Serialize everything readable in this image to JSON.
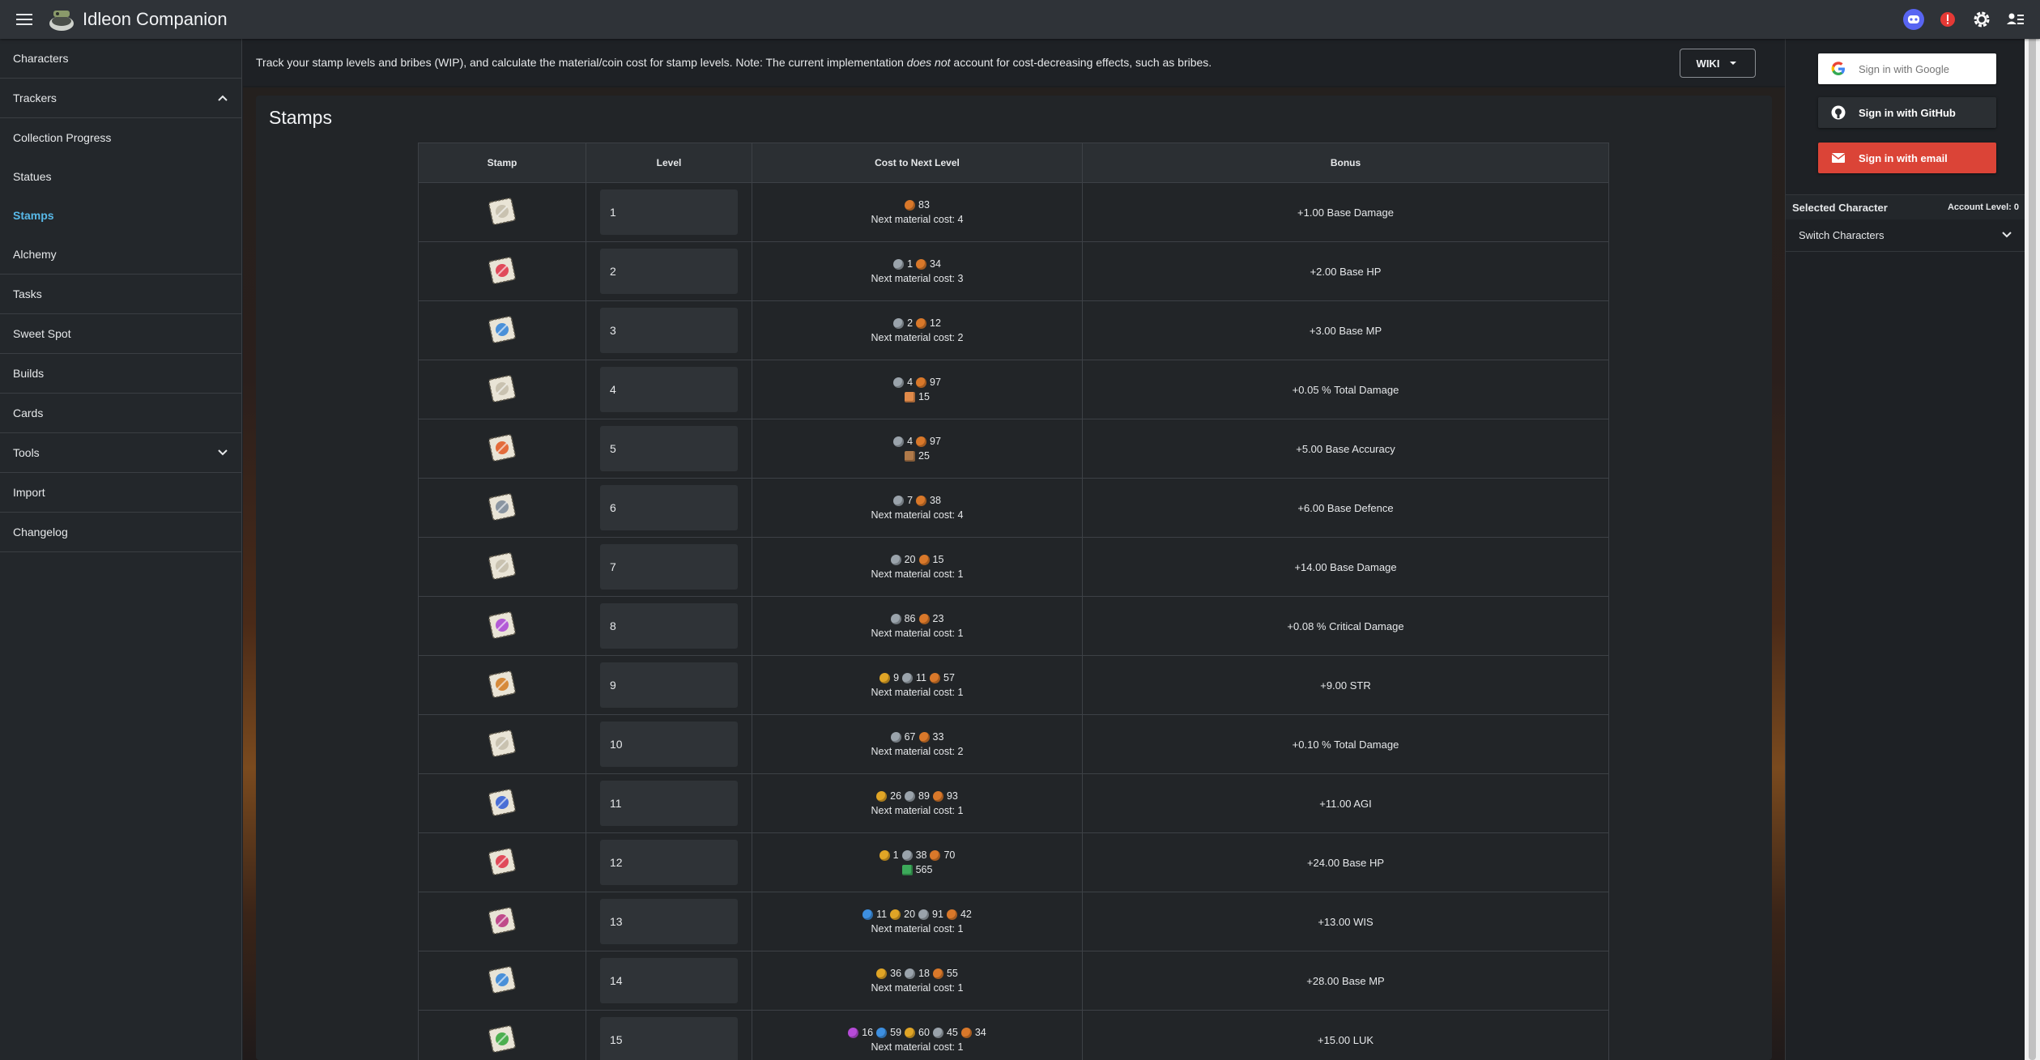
{
  "app": {
    "title": "Idleon Companion"
  },
  "sidebar": {
    "items": [
      {
        "label": "Characters"
      },
      {
        "label": "Trackers"
      },
      {
        "label": "Collection Progress"
      },
      {
        "label": "Statues"
      },
      {
        "label": "Stamps"
      },
      {
        "label": "Alchemy"
      },
      {
        "label": "Tasks"
      },
      {
        "label": "Sweet Spot"
      },
      {
        "label": "Builds"
      },
      {
        "label": "Cards"
      },
      {
        "label": "Tools"
      },
      {
        "label": "Import"
      },
      {
        "label": "Changelog"
      }
    ]
  },
  "info": {
    "text_before": "Track your stamp levels and bribes (WIP), and calculate the material/coin cost for stamp levels. Note: The current implementation ",
    "text_em": "does not",
    "text_after": " account for cost-decreasing effects, such as bribes.",
    "wiki_label": "WIKI"
  },
  "page": {
    "title": "Stamps"
  },
  "table": {
    "headers": [
      "Stamp",
      "Level",
      "Cost to Next Level",
      "Bonus"
    ],
    "rows": [
      {
        "stamp_icon": "sword-stamp-icon",
        "level": "1",
        "cost_line": [
          {
            "coin": "copper",
            "v": "83"
          }
        ],
        "cost_sub": "Next material cost: 4",
        "bonus": "+1.00 Base Damage"
      },
      {
        "stamp_icon": "heart-stamp-icon",
        "level": "2",
        "cost_line": [
          {
            "coin": "silver",
            "v": "1"
          },
          {
            "coin": "copper",
            "v": "34"
          }
        ],
        "cost_sub": "Next material cost: 3",
        "bonus": "+2.00 Base HP"
      },
      {
        "stamp_icon": "mana-stamp-icon",
        "level": "3",
        "cost_line": [
          {
            "coin": "silver",
            "v": "2"
          },
          {
            "coin": "copper",
            "v": "12"
          }
        ],
        "cost_sub": "Next material cost: 2",
        "bonus": "+3.00 Base MP"
      },
      {
        "stamp_icon": "sword-stamp-icon",
        "level": "4",
        "cost_line": [
          {
            "coin": "silver",
            "v": "4"
          },
          {
            "coin": "copper",
            "v": "97"
          }
        ],
        "cost_sub_icon": "material-bar-icon",
        "cost_sub": "15",
        "bonus": "+0.05 % Total Damage"
      },
      {
        "stamp_icon": "target-stamp-icon",
        "level": "5",
        "cost_line": [
          {
            "coin": "silver",
            "v": "4"
          },
          {
            "coin": "copper",
            "v": "97"
          }
        ],
        "cost_sub_icon": "material-jar-icon",
        "cost_sub": "25",
        "bonus": "+5.00 Base Accuracy"
      },
      {
        "stamp_icon": "shield-stamp-icon",
        "level": "6",
        "cost_line": [
          {
            "coin": "silver",
            "v": "7"
          },
          {
            "coin": "copper",
            "v": "38"
          }
        ],
        "cost_sub": "Next material cost: 4",
        "bonus": "+6.00 Base Defence"
      },
      {
        "stamp_icon": "sword-stamp-icon",
        "level": "7",
        "cost_line": [
          {
            "coin": "silver",
            "v": "20"
          },
          {
            "coin": "copper",
            "v": "15"
          }
        ],
        "cost_sub": "Next material cost: 1",
        "bonus": "+14.00 Base Damage"
      },
      {
        "stamp_icon": "crit-stamp-icon",
        "level": "8",
        "cost_line": [
          {
            "coin": "silver",
            "v": "86"
          },
          {
            "coin": "copper",
            "v": "23"
          }
        ],
        "cost_sub": "Next material cost: 1",
        "bonus": "+0.08 % Critical Damage"
      },
      {
        "stamp_icon": "fist-stamp-icon",
        "level": "9",
        "cost_line": [
          {
            "coin": "gold",
            "v": "9"
          },
          {
            "coin": "silver",
            "v": "11"
          },
          {
            "coin": "copper",
            "v": "57"
          }
        ],
        "cost_sub": "Next material cost: 1",
        "bonus": "+9.00 STR"
      },
      {
        "stamp_icon": "sword-stamp-icon",
        "level": "10",
        "cost_line": [
          {
            "coin": "silver",
            "v": "67"
          },
          {
            "coin": "copper",
            "v": "33"
          }
        ],
        "cost_sub": "Next material cost: 2",
        "bonus": "+0.10 % Total Damage"
      },
      {
        "stamp_icon": "boot-stamp-icon",
        "level": "11",
        "cost_line": [
          {
            "coin": "gold",
            "v": "26"
          },
          {
            "coin": "silver",
            "v": "89"
          },
          {
            "coin": "copper",
            "v": "93"
          }
        ],
        "cost_sub": "Next material cost: 1",
        "bonus": "+11.00 AGI"
      },
      {
        "stamp_icon": "heart-stamp-icon",
        "level": "12",
        "cost_line": [
          {
            "coin": "gold",
            "v": "1"
          },
          {
            "coin": "silver",
            "v": "38"
          },
          {
            "coin": "copper",
            "v": "70"
          }
        ],
        "cost_sub_icon": "material-leaf-icon",
        "cost_sub": "565",
        "bonus": "+24.00 Base HP"
      },
      {
        "stamp_icon": "brain-stamp-icon",
        "level": "13",
        "cost_line": [
          {
            "coin": "blue",
            "v": "11"
          },
          {
            "coin": "gold",
            "v": "20"
          },
          {
            "coin": "silver",
            "v": "91"
          },
          {
            "coin": "copper",
            "v": "42"
          }
        ],
        "cost_sub": "Next material cost: 1",
        "bonus": "+13.00 WIS"
      },
      {
        "stamp_icon": "mana-stamp-icon",
        "level": "14",
        "cost_line": [
          {
            "coin": "gold",
            "v": "36"
          },
          {
            "coin": "silver",
            "v": "18"
          },
          {
            "coin": "copper",
            "v": "55"
          }
        ],
        "cost_sub": "Next material cost: 1",
        "bonus": "+28.00 Base MP"
      },
      {
        "stamp_icon": "clover-stamp-icon",
        "level": "15",
        "cost_line": [
          {
            "coin": "purple",
            "v": "16"
          },
          {
            "coin": "blue",
            "v": "59"
          },
          {
            "coin": "gold",
            "v": "60"
          },
          {
            "coin": "silver",
            "v": "45"
          },
          {
            "coin": "copper",
            "v": "34"
          }
        ],
        "cost_sub": "Next material cost: 1",
        "bonus": "+15.00 LUK"
      }
    ]
  },
  "coin_colors": {
    "copper": "#d9782a",
    "silver": "#9aa3ab",
    "gold": "#e0a526",
    "blue": "#3d8fe0",
    "purple": "#b64bd8"
  },
  "auth": {
    "google": "Sign in with Google",
    "github": "Sign in with GitHub",
    "email": "Sign in with email"
  },
  "character": {
    "selected_label": "Selected Character",
    "account_level": "Account Level: 0",
    "switch_label": "Switch Characters"
  }
}
